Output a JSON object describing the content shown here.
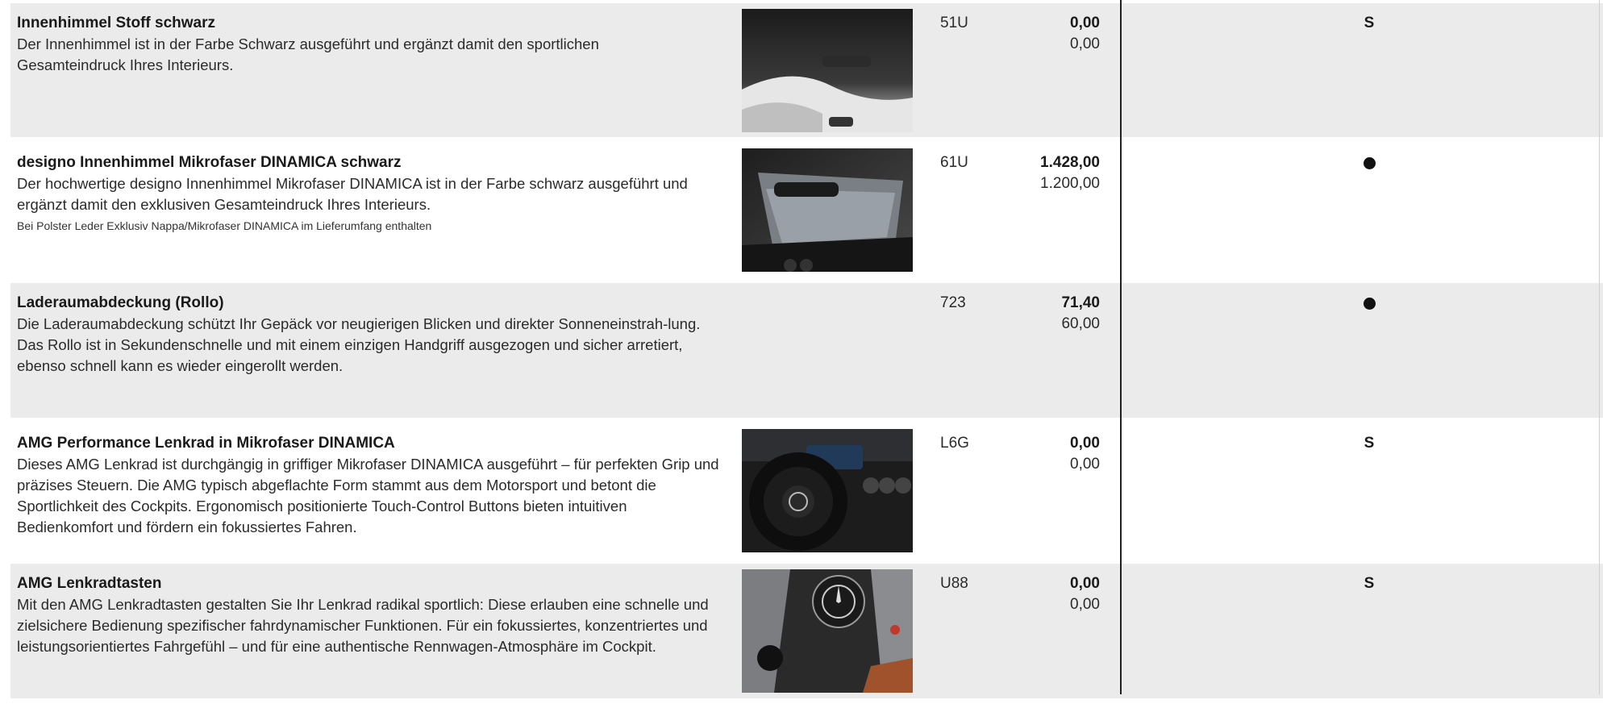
{
  "rows": [
    {
      "title": "Innenhimmel Stoff schwarz",
      "desc": "Der Innenhimmel ist in der Farbe Schwarz ausgeführt und ergänzt damit den sportlichen Gesamteindruck Ihres Interieurs.",
      "note": "",
      "code": "51U",
      "price_gross": "0,00",
      "price_net": "0,00",
      "availability": "S",
      "image": "headliner-fabric-black-photo"
    },
    {
      "title": "designo Innenhimmel Mikrofaser DINAMICA schwarz",
      "desc": "Der hochwertige designo Innenhimmel Mikrofaser DINAMICA ist in der Farbe schwarz ausgeführt und ergänzt damit den exklusiven Gesamteindruck Ihres Interieurs.",
      "note": "Bei Polster Leder Exklusiv Nappa/Mikrofaser DINAMICA im Lieferumfang enthalten",
      "code": "61U",
      "price_gross": "1.428,00",
      "price_net": "1.200,00",
      "availability": "●",
      "image": "headliner-dinamica-photo"
    },
    {
      "title": "Laderaumabdeckung (Rollo)",
      "desc": "Die Laderaumabdeckung schützt Ihr Gepäck vor neugierigen Blicken und direkter Sonneneinstrah-lung. Das Rollo ist in Sekundenschnelle und mit einem einzigen Handgriff ausgezogen und sicher arretiert, ebenso schnell kann es wieder eingerollt werden.",
      "note": "",
      "code": "723",
      "price_gross": "71,40",
      "price_net": "60,00",
      "availability": "●",
      "image": ""
    },
    {
      "title": "AMG Performance Lenkrad in Mikrofaser DINAMICA",
      "desc": "Dieses AMG Lenkrad ist durchgängig in griffiger Mikrofaser DINAMICA ausgeführt – für perfekten Grip und präzises Steuern. Die AMG typisch abgeflachte Form stammt aus dem Motorsport und betont die Sportlichkeit des Cockpits. Ergonomisch positionierte Touch-Control Buttons bieten intuitiven Bedienkomfort und fördern ein fokussiertes Fahren.",
      "note": "",
      "code": "L6G",
      "price_gross": "0,00",
      "price_net": "0,00",
      "availability": "S",
      "image": "steering-wheel-photo"
    },
    {
      "title": "AMG Lenkradtasten",
      "desc": "Mit den AMG Lenkradtasten gestalten Sie Ihr Lenkrad radikal sportlich: Diese erlauben eine schnelle und zielsichere Bedienung spezifischer fahrdynamischer Funktionen. Für ein fokussiertes, konzentriertes und leistungsorientiertes Fahrgefühl – und für eine authentische Rennwagen-Atmosphäre im Cockpit.",
      "note": "",
      "code": "U88",
      "price_gross": "0,00",
      "price_net": "0,00",
      "availability": "S",
      "image": "steering-wheel-buttons-photo"
    }
  ]
}
